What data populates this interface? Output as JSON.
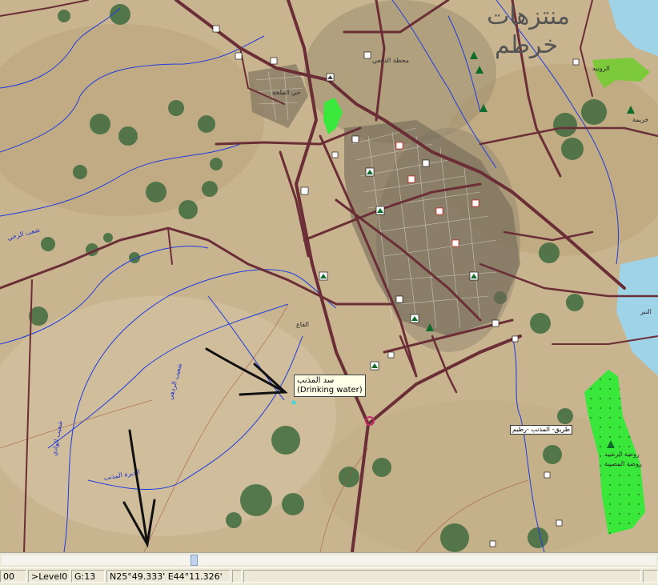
{
  "map": {
    "title_line1": "منتزهات",
    "title_line2": "خرطم",
    "tooltip": {
      "name": "سد المذنب",
      "category": "(Drinking water)"
    },
    "road_tag": "طريق- المذنب -رطيم",
    "place_labels": [
      "الرونيه",
      "خريمة",
      "روضة الرشيد",
      "روضة المصيبة",
      "النبر",
      "محطة الدفعي",
      "القاع",
      "حي الملحة",
      "شعيب الردهي",
      "شعيب الوادي",
      "الديرة المذنب",
      "شعب الرحي"
    ],
    "colors": {
      "terrain": "#c8b48f",
      "road": "#6b2e36",
      "river": "#1e3be0",
      "park": "#39e83a",
      "water": "#9fd3e8",
      "field": "#3f6b3e"
    },
    "icons": [
      "school-icon",
      "mosque-icon",
      "tree-icon",
      "fuel-icon",
      "hospital-icon",
      "shop-icon"
    ]
  },
  "scrollbar": {
    "position": 0.29
  },
  "status": {
    "cell1": "00",
    "level": ">Level0",
    "grid": "G:13",
    "coords": "N25°49.333' E44°11.326'"
  }
}
